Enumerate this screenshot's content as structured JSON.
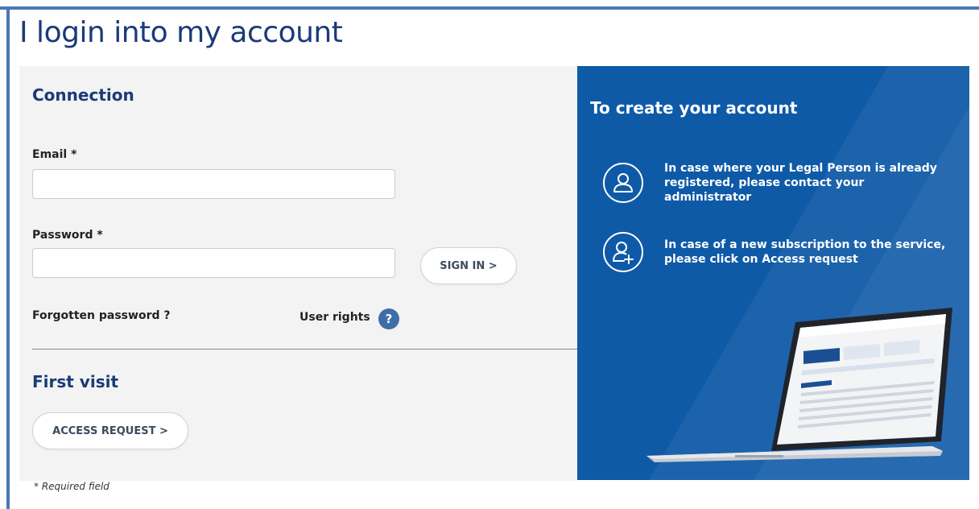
{
  "page": {
    "title": "I login into my account",
    "required_note": "* Required field"
  },
  "connection": {
    "title": "Connection",
    "email_label": "Email *",
    "email_value": "",
    "password_label": "Password *",
    "password_value": "",
    "sign_in_label": "SIGN IN >",
    "forgotten_password": "Forgotten password ?",
    "user_rights": "User rights",
    "help_symbol": "?"
  },
  "first_visit": {
    "title": "First visit",
    "access_request_label": "ACCESS REQUEST >"
  },
  "create_account": {
    "title": "To create your account",
    "items": [
      {
        "icon": "user-icon",
        "text": "In case where your Legal Person is already registered, please contact your administrator"
      },
      {
        "icon": "user-add-icon",
        "text": "In case of a new subscription to the service, please click on Access request"
      }
    ]
  },
  "colors": {
    "brand_dark": "#1b3a78",
    "panel_blue": "#0e5aa7",
    "frame_blue": "#4a78b5",
    "help_blue": "#3e6ea6"
  }
}
